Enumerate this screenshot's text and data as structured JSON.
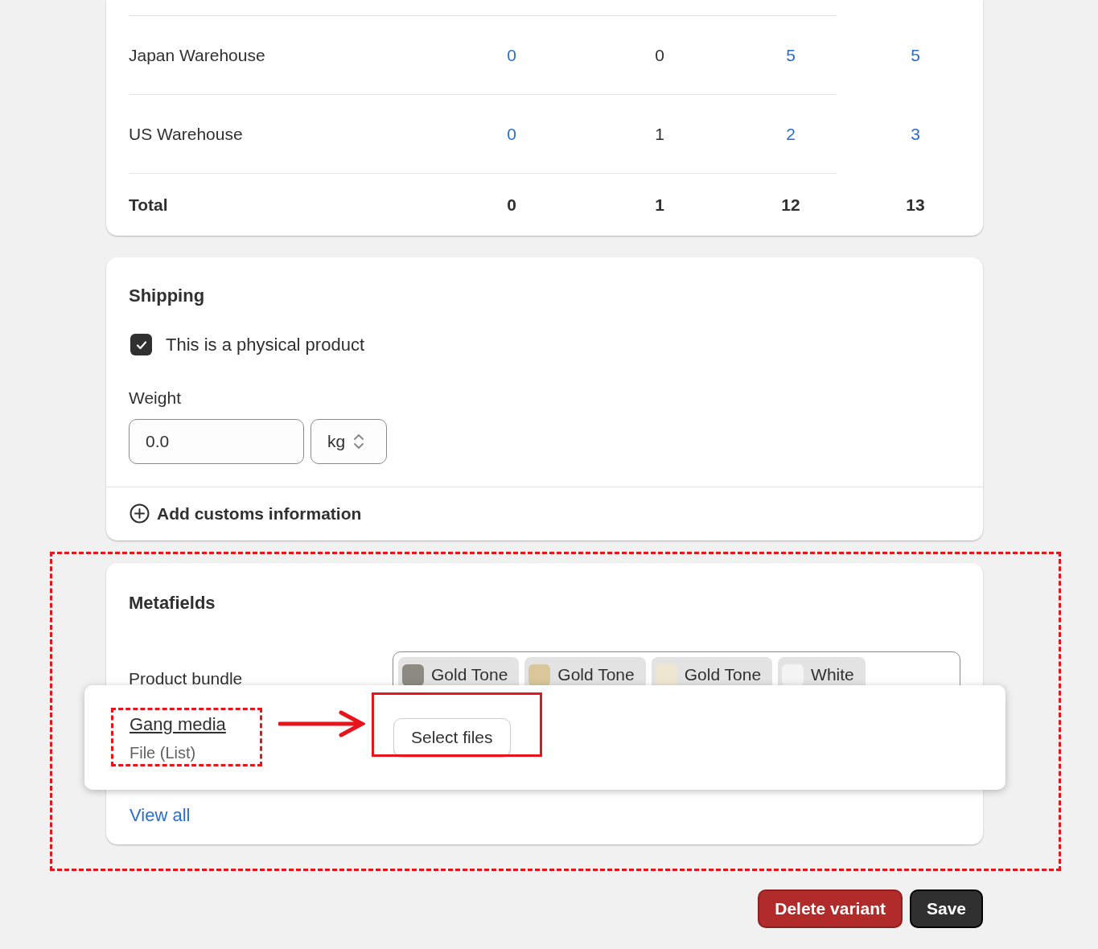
{
  "inventory_table": {
    "rows": [
      {
        "label": "Japan Warehouse",
        "total": false,
        "cells": [
          {
            "text": "0",
            "link": true
          },
          {
            "text": "0",
            "link": false
          },
          {
            "text": "5",
            "link": true
          },
          {
            "text": "5",
            "link": true
          }
        ]
      },
      {
        "label": "US Warehouse",
        "total": false,
        "cells": [
          {
            "text": "0",
            "link": true
          },
          {
            "text": "1",
            "link": false
          },
          {
            "text": "2",
            "link": true
          },
          {
            "text": "3",
            "link": true
          }
        ]
      },
      {
        "label": "Total",
        "total": true,
        "cells": [
          {
            "text": "0",
            "link": false
          },
          {
            "text": "1",
            "link": false
          },
          {
            "text": "12",
            "link": false
          },
          {
            "text": "13",
            "link": false
          }
        ]
      }
    ]
  },
  "shipping": {
    "title": "Shipping",
    "physical_product": {
      "label": "This is a physical product",
      "checked": true
    },
    "weight": {
      "label": "Weight",
      "value": "0.0",
      "unit": "kg"
    },
    "customs_link": "Add customs information"
  },
  "metafields": {
    "title": "Metafields",
    "product_bundle": {
      "label": "Product bundle",
      "chips": [
        {
          "label": "Gold Tone"
        },
        {
          "label": "Gold Tone"
        },
        {
          "label": "Gold Tone"
        },
        {
          "label": "White"
        }
      ]
    },
    "popup": {
      "name": "Gang media",
      "type": "File (List)",
      "button": "Select files"
    },
    "view_all": "View all"
  },
  "buttons": [
    {
      "label": "Delete variant",
      "kind": "danger"
    },
    {
      "label": "Save",
      "kind": "primary"
    }
  ]
}
